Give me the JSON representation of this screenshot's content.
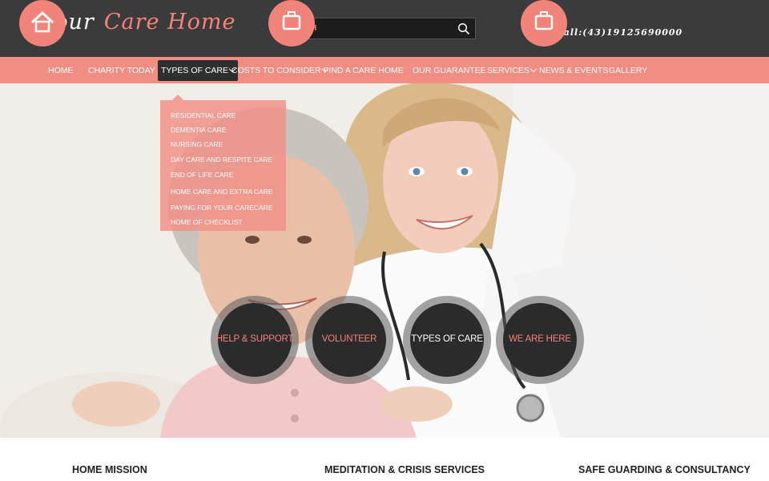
{
  "logo": {
    "word1": "your",
    "word2": "Care Home"
  },
  "search": {
    "placeholder": "SEARCH"
  },
  "phone": "Call:(43)19125690000",
  "nav": {
    "items": [
      {
        "label": "HOME"
      },
      {
        "label": "CHARITY TODAY"
      },
      {
        "label": "TYPES OF CARE"
      },
      {
        "label": "COSTS TO CONSIDER"
      },
      {
        "label": "FIND A CARE HOME"
      },
      {
        "label": "OUR GUARANTEE"
      },
      {
        "label": "SERVICES"
      },
      {
        "label": "NEWS & EVENTS"
      },
      {
        "label": "GALLERY"
      }
    ]
  },
  "dropdown": {
    "items": [
      "RESIDENTIAL CARE",
      "DEMENTIA CARE",
      "NURSING CARE",
      "DAY CARE AND RESPITE CARE",
      "END OF LIFE CARE",
      "HOME CARE AND EXTRA CARE",
      "PAYING FOR YOUR CARECARE",
      "HOME OF CHECKLIST"
    ]
  },
  "circles": [
    {
      "label": "HELP & SUPPORT",
      "color": "#f4837a"
    },
    {
      "label": "VOLUNTEER",
      "color": "#f4837a"
    },
    {
      "label": "TYPES OF CARE",
      "color": "#ffffff"
    },
    {
      "label": "WE ARE HERE",
      "color": "#f4837a"
    }
  ],
  "features": [
    {
      "title": "HOME MISSION",
      "icon": "house-icon"
    },
    {
      "title": "MEDITATION & CRISIS SERVICES",
      "icon": "medical-kit-icon"
    },
    {
      "title": "SAFE GUARDING & CONSULTANCY",
      "icon": "medical-kit-icon"
    }
  ],
  "colors": {
    "accent": "#f0837a",
    "header": "#3b3b3b",
    "dark": "#2b2b2b"
  }
}
